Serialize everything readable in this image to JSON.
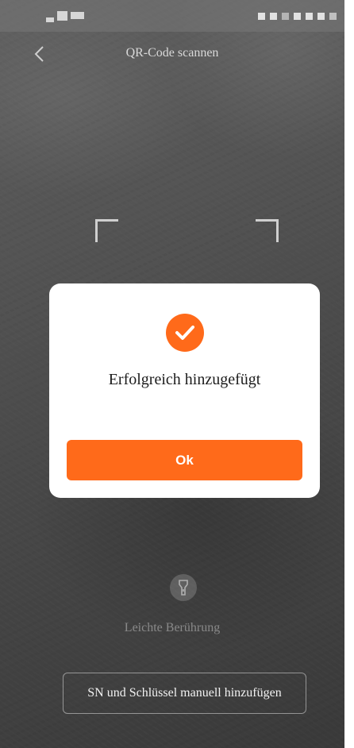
{
  "header": {
    "title": "QR-Code scannen",
    "back_icon": "chevron-left-icon"
  },
  "dialog": {
    "icon": "check-circle-icon",
    "message": "Erfolgreich hinzugefügt",
    "ok_label": "Ok"
  },
  "flashlight": {
    "icon": "flashlight-icon",
    "label": "Leichte Berührung"
  },
  "manual_button": {
    "label": "SN und Schlüssel manuell hinzufügen"
  },
  "colors": {
    "accent": "#ff6a1a",
    "dialog_bg": "#ffffff"
  }
}
